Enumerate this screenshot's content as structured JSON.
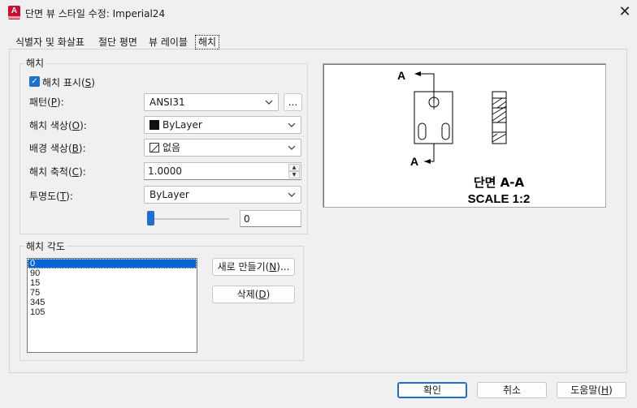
{
  "window": {
    "app_icon_letter": "A",
    "title": "단면 뷰 스타일 수정: Imperial24",
    "close_glyph": "✕"
  },
  "tabs": [
    {
      "label": "식별자 및 화살표",
      "active": false
    },
    {
      "label": "절단 평면",
      "active": false
    },
    {
      "label": "뷰 레이블",
      "active": false
    },
    {
      "label": "해치",
      "active": true
    }
  ],
  "hatch": {
    "group_title": "해치",
    "show_hatch": {
      "label_pre": "해치 표시(",
      "key": "S",
      "label_post": ")",
      "checked": true
    },
    "pattern": {
      "label_pre": "패턴(",
      "key": "P",
      "label_post": "):",
      "value": "ANSI31",
      "browse_label": "..."
    },
    "hatch_color": {
      "label_pre": "해치 색상(",
      "key": "O",
      "label_post": "):",
      "value": "ByLayer"
    },
    "bg_color": {
      "label_pre": "배경 색상(",
      "key": "B",
      "label_post": "):",
      "value": "없음"
    },
    "scale": {
      "label_pre": "해치 축척(",
      "key": "C",
      "label_post": "):",
      "value": "1.0000"
    },
    "transparency": {
      "label_pre": "투명도(",
      "key": "T",
      "label_post": "):",
      "value": "ByLayer",
      "slider_value": "0",
      "slider_fraction": 0
    }
  },
  "angles": {
    "group_title": "해치 각도",
    "items": [
      "0",
      "90",
      "15",
      "75",
      "345",
      "105"
    ],
    "selected_index": 0,
    "new_button": {
      "label_pre": "새로 만들기(",
      "key": "N",
      "label_post": ")..."
    },
    "delete_button": {
      "label_pre": "삭제(",
      "key": "D",
      "label_post": ")"
    }
  },
  "preview": {
    "marker_top": "A",
    "marker_bottom": "A",
    "section_title": "단면 A-A",
    "scale_text": "SCALE 1:2"
  },
  "footer": {
    "ok": {
      "label": "확인"
    },
    "cancel": {
      "label": "취소"
    },
    "help": {
      "label_pre": "도움말(",
      "key": "H",
      "label_post": ")"
    }
  },
  "colors": {
    "accent": "#1e6fd0",
    "app_icon": "#c8102e",
    "list_selection": "#0a64d6"
  }
}
